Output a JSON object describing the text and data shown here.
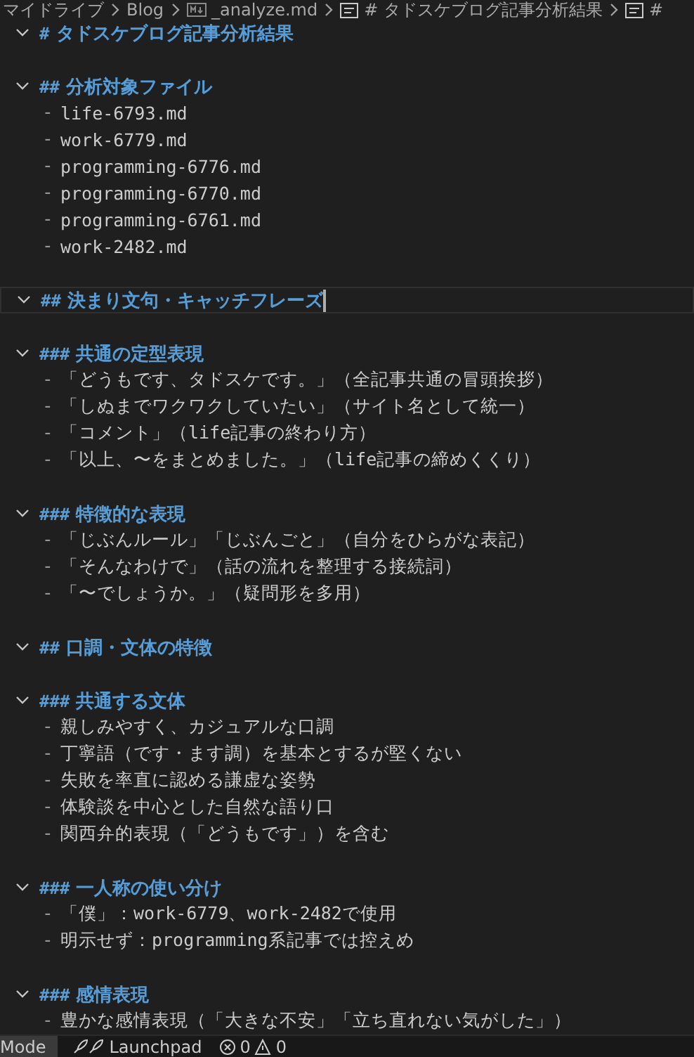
{
  "breadcrumb": [
    {
      "kind": "folder",
      "label": "マイドライブ"
    },
    {
      "kind": "folder",
      "label": "Blog"
    },
    {
      "kind": "file",
      "label": "_analyze.md"
    },
    {
      "kind": "symbol",
      "label": "# タドスケブログ記事分析結果"
    },
    {
      "kind": "symbol",
      "label": "#"
    }
  ],
  "lines": [
    {
      "kind": "heading",
      "marker": "#",
      "text": "タドスケブログ記事分析結果",
      "expanded": true,
      "current": false
    },
    {
      "kind": "blank",
      "current": false
    },
    {
      "kind": "heading",
      "marker": "##",
      "text": "分析対象ファイル",
      "expanded": true,
      "current": false
    },
    {
      "kind": "item",
      "bullet": "-",
      "text": "life-6793.md",
      "current": false
    },
    {
      "kind": "item",
      "bullet": "-",
      "text": "work-6779.md",
      "current": false
    },
    {
      "kind": "item",
      "bullet": "-",
      "text": "programming-6776.md",
      "current": false
    },
    {
      "kind": "item",
      "bullet": "-",
      "text": "programming-6770.md",
      "current": false
    },
    {
      "kind": "item",
      "bullet": "-",
      "text": "programming-6761.md",
      "current": false
    },
    {
      "kind": "item",
      "bullet": "-",
      "text": "work-2482.md",
      "current": false
    },
    {
      "kind": "blank",
      "current": false
    },
    {
      "kind": "heading",
      "marker": "##",
      "text": "決まり文句・キャッチフレーズ",
      "expanded": true,
      "current": true
    },
    {
      "kind": "blank",
      "current": false
    },
    {
      "kind": "heading",
      "marker": "###",
      "text": "共通の定型表現",
      "expanded": true,
      "current": false
    },
    {
      "kind": "item",
      "bullet": "-",
      "text": "「どうもです、タドスケです。」（全記事共通の冒頭挨拶）",
      "current": false
    },
    {
      "kind": "item",
      "bullet": "-",
      "text": "「しぬまでワクワクしていたい」（サイト名として統一）",
      "current": false
    },
    {
      "kind": "item",
      "bullet": "-",
      "text": "「コメント」（life記事の終わり方）",
      "current": false
    },
    {
      "kind": "item",
      "bullet": "-",
      "text": "「以上、〜をまとめました。」（life記事の締めくくり）",
      "current": false
    },
    {
      "kind": "blank",
      "current": false
    },
    {
      "kind": "heading",
      "marker": "###",
      "text": "特徴的な表現",
      "expanded": true,
      "current": false
    },
    {
      "kind": "item",
      "bullet": "-",
      "text": "「じぶんルール」「じぶんごと」（自分をひらがな表記）",
      "current": false
    },
    {
      "kind": "item",
      "bullet": "-",
      "text": "「そんなわけで」（話の流れを整理する接続詞）",
      "current": false
    },
    {
      "kind": "item",
      "bullet": "-",
      "text": "「〜でしょうか。」（疑問形を多用）",
      "current": false
    },
    {
      "kind": "blank",
      "current": false
    },
    {
      "kind": "heading",
      "marker": "##",
      "text": "口調・文体の特徴",
      "expanded": true,
      "current": false
    },
    {
      "kind": "blank",
      "current": false
    },
    {
      "kind": "heading",
      "marker": "###",
      "text": "共通する文体",
      "expanded": true,
      "current": false
    },
    {
      "kind": "item",
      "bullet": "-",
      "text": "親しみやすく、カジュアルな口調",
      "current": false
    },
    {
      "kind": "item",
      "bullet": "-",
      "text": "丁寧語（です・ます調）を基本とするが堅くない",
      "current": false
    },
    {
      "kind": "item",
      "bullet": "-",
      "text": "失敗を率直に認める謙虚な姿勢",
      "current": false
    },
    {
      "kind": "item",
      "bullet": "-",
      "text": "体験談を中心とした自然な語り口",
      "current": false
    },
    {
      "kind": "item",
      "bullet": "-",
      "text": "関西弁的表現（「どうもです」）を含む",
      "current": false
    },
    {
      "kind": "blank",
      "current": false
    },
    {
      "kind": "heading",
      "marker": "###",
      "text": "一人称の使い分け",
      "expanded": true,
      "current": false
    },
    {
      "kind": "item",
      "bullet": "-",
      "text": "「僕」：work-6779、work-2482で使用",
      "current": false
    },
    {
      "kind": "item",
      "bullet": "-",
      "text": "明示せず：programming系記事では控えめ",
      "current": false
    },
    {
      "kind": "blank",
      "current": false
    },
    {
      "kind": "heading",
      "marker": "###",
      "text": "感情表現",
      "expanded": true,
      "current": false
    },
    {
      "kind": "item",
      "bullet": "-",
      "text": "豊かな感情表現（「大きな不安」「立ち直れない気がした」）",
      "current": false
    }
  ],
  "status_bar": {
    "mode": "Mode",
    "launchpad": "Launchpad",
    "errors": "0",
    "warnings": "0"
  }
}
